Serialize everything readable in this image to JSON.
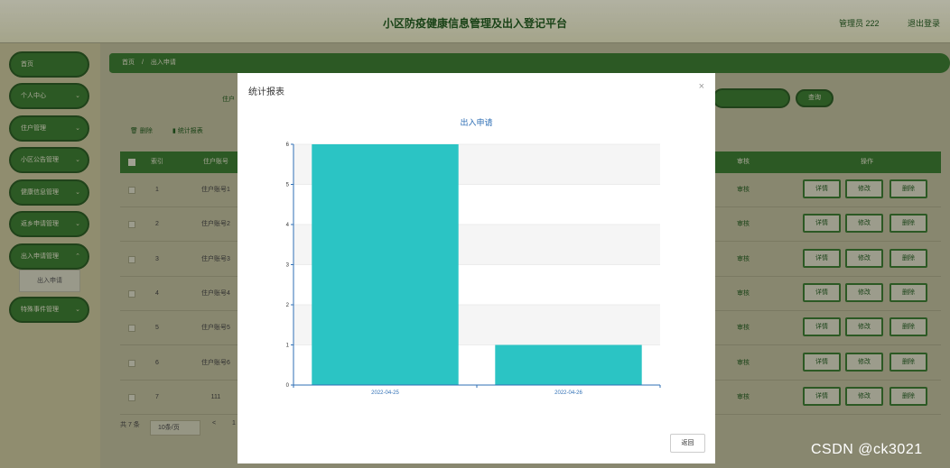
{
  "header": {
    "title": "小区防疫健康信息管理及出入登记平台",
    "user": "管理员 222",
    "logout": "退出登录"
  },
  "sidebar": {
    "items": [
      {
        "label": "首页"
      },
      {
        "label": "个人中心"
      },
      {
        "label": "住户管理"
      },
      {
        "label": "小区公告管理"
      },
      {
        "label": "健康信息管理"
      },
      {
        "label": "返乡申请管理"
      },
      {
        "label": "出入申请管理"
      },
      {
        "label": "特殊事件管理"
      }
    ],
    "sub_item": "出入申请"
  },
  "breadcrumb": {
    "home": "首页",
    "sep": "/",
    "current": "出入申请"
  },
  "search": {
    "label": "住户",
    "button": "查询"
  },
  "toolbar": {
    "delete": "删除",
    "stats": "统计报表"
  },
  "table": {
    "headers": {
      "index": "索引",
      "account": "住户账号",
      "audit": "审核",
      "ops": "操作"
    },
    "rows": [
      {
        "index": "1",
        "account": "住户账号1"
      },
      {
        "index": "2",
        "account": "住户账号2"
      },
      {
        "index": "3",
        "account": "住户账号3"
      },
      {
        "index": "4",
        "account": "住户账号4"
      },
      {
        "index": "5",
        "account": "住户账号5"
      },
      {
        "index": "6",
        "account": "住户账号6"
      },
      {
        "index": "7",
        "account": "111"
      }
    ],
    "audit_label": "审核",
    "op_labels": {
      "detail": "详情",
      "edit": "修改",
      "delete": "删除"
    }
  },
  "pager": {
    "total": "共 7 条",
    "page_size": "10条/页",
    "prev": "<",
    "page": "1"
  },
  "modal": {
    "title": "统计报表",
    "close": "×",
    "return_button": "返回"
  },
  "chart_data": {
    "type": "bar",
    "title": "出入申请",
    "categories": [
      "2022-04-25",
      "2022-04-26"
    ],
    "values": [
      6,
      1
    ],
    "ylim": [
      0,
      6
    ],
    "yticks": [
      "0",
      "1",
      "2",
      "3",
      "4",
      "5",
      "6"
    ],
    "grid": true,
    "bar_color": "#2bc4c4",
    "axis_color": "#2f6fb5"
  },
  "watermark": "CSDN @ck3021"
}
